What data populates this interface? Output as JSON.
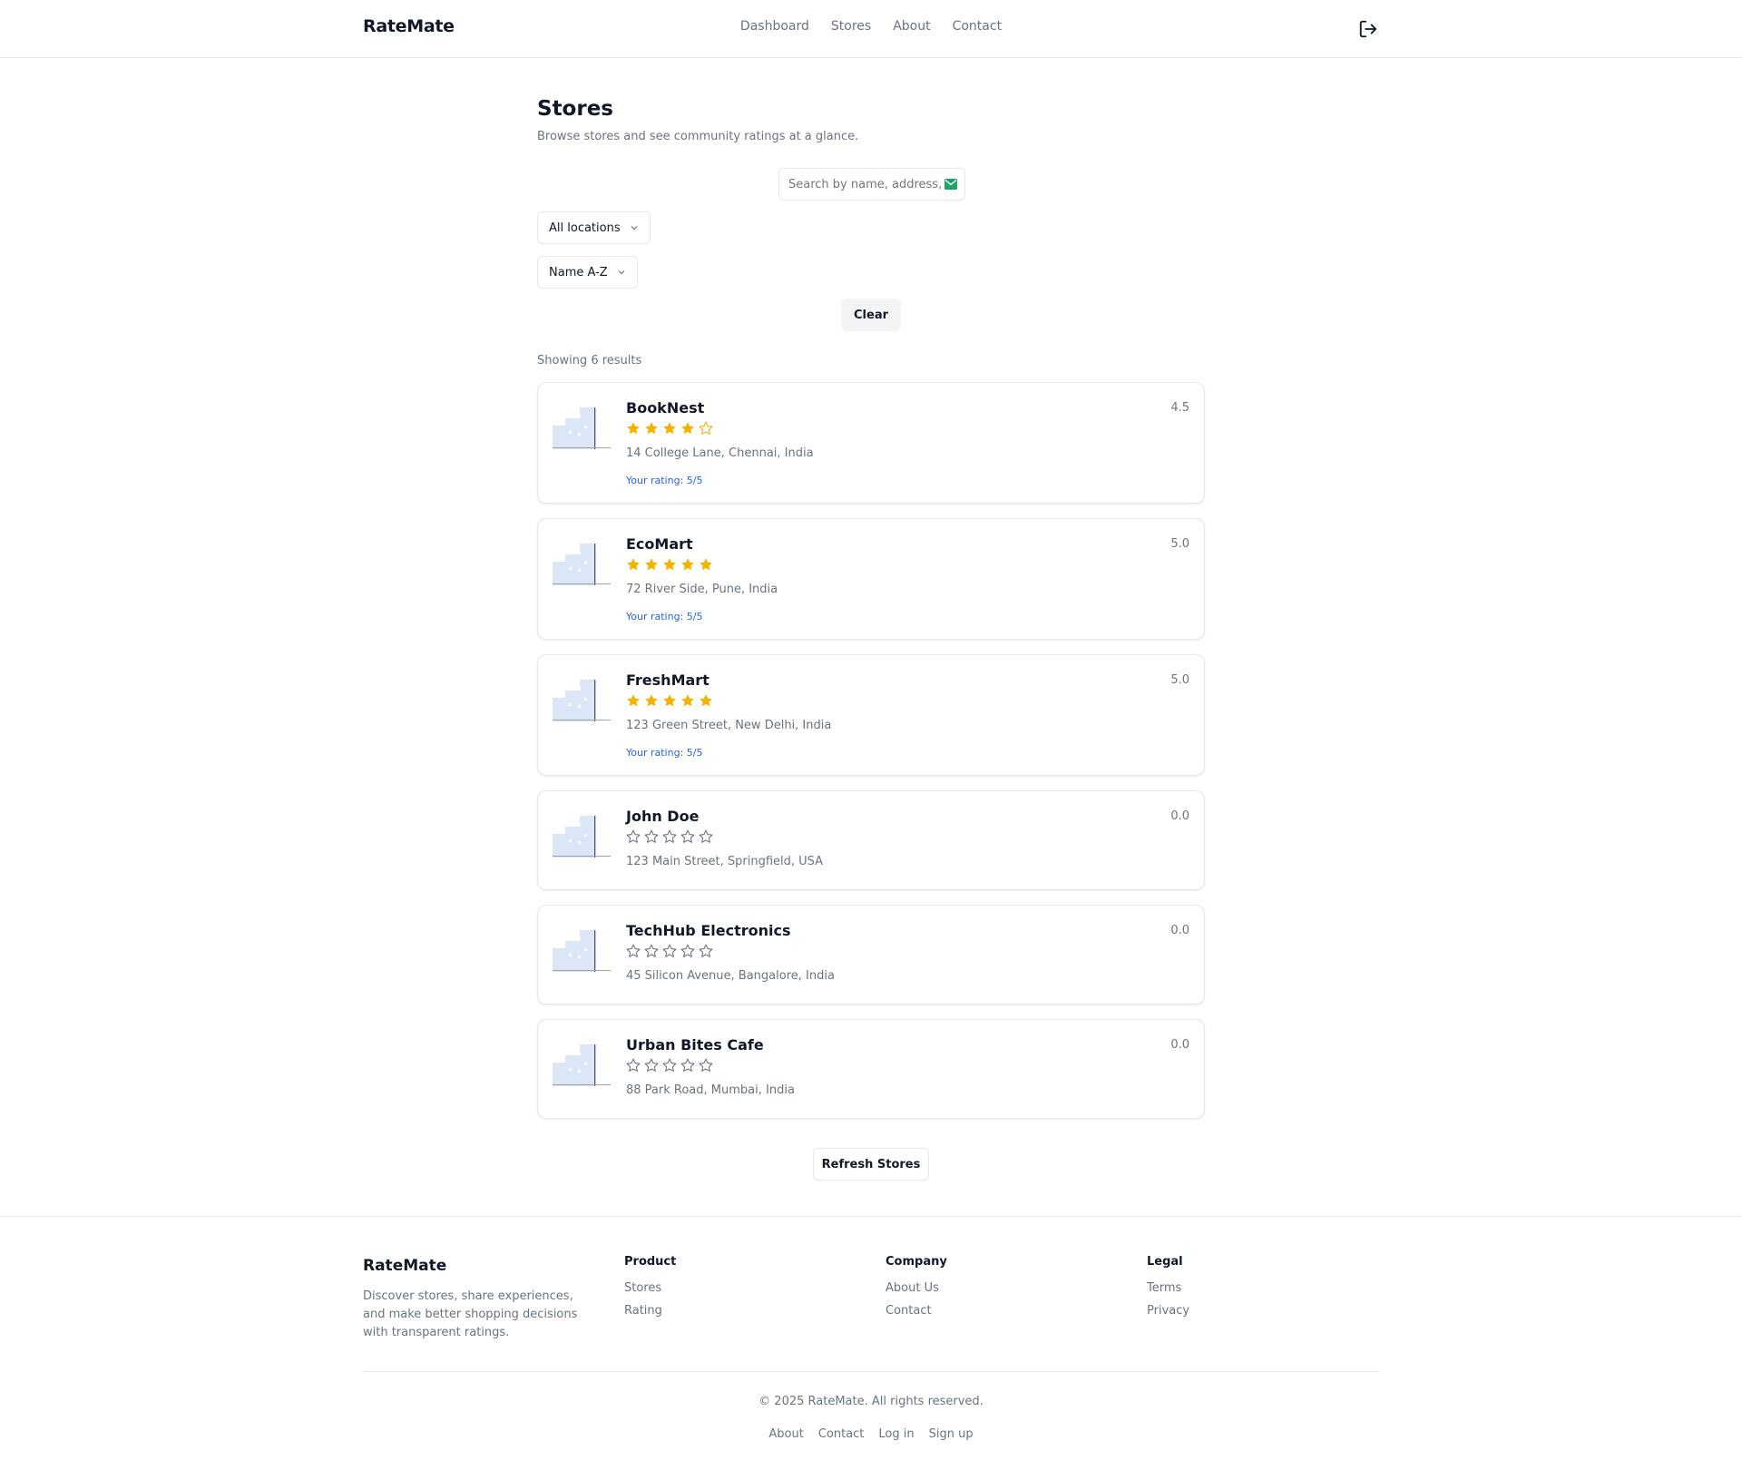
{
  "header": {
    "brand": "RateMate",
    "nav": [
      "Dashboard",
      "Stores",
      "About",
      "Contact"
    ]
  },
  "page": {
    "title": "Stores",
    "subtitle": "Browse stores and see community ratings at a glance."
  },
  "filters": {
    "search_placeholder": "Search by name, address, or email",
    "location_value": "All locations",
    "sort_value": "Name A-Z",
    "clear_label": "Clear"
  },
  "results_text": "Showing 6 results",
  "colors": {
    "star_filled": "#f5b301",
    "star_empty": "#6b7280",
    "rating_link": "#2563eb"
  },
  "stores": [
    {
      "name": "BookNest",
      "address": "14 College Lane, Chennai, India",
      "score": "4.5",
      "stars": 4,
      "your_rating": "Your rating: 5/5"
    },
    {
      "name": "EcoMart",
      "address": "72 River Side, Pune, India",
      "score": "5.0",
      "stars": 5,
      "your_rating": "Your rating: 5/5"
    },
    {
      "name": "FreshMart",
      "address": "123 Green Street, New Delhi, India",
      "score": "5.0",
      "stars": 5,
      "your_rating": "Your rating: 5/5"
    },
    {
      "name": "John Doe",
      "address": "123 Main Street, Springfield, USA",
      "score": "0.0",
      "stars": 0,
      "your_rating": ""
    },
    {
      "name": "TechHub Electronics",
      "address": "45 Silicon Avenue, Bangalore, India",
      "score": "0.0",
      "stars": 0,
      "your_rating": ""
    },
    {
      "name": "Urban Bites Cafe",
      "address": "88 Park Road, Mumbai, India",
      "score": "0.0",
      "stars": 0,
      "your_rating": ""
    }
  ],
  "refresh_label": "Refresh Stores",
  "footer": {
    "brand": "RateMate",
    "description": "Discover stores, share experiences, and make better shopping decisions with transparent ratings.",
    "columns": [
      {
        "title": "Product",
        "links": [
          "Stores",
          "Rating"
        ]
      },
      {
        "title": "Company",
        "links": [
          "About Us",
          "Contact"
        ]
      },
      {
        "title": "Legal",
        "links": [
          "Terms",
          "Privacy"
        ]
      }
    ],
    "copyright": "© 2025 RateMate. All rights reserved.",
    "bottom_links": [
      "About",
      "Contact",
      "Log in",
      "Sign up"
    ]
  }
}
